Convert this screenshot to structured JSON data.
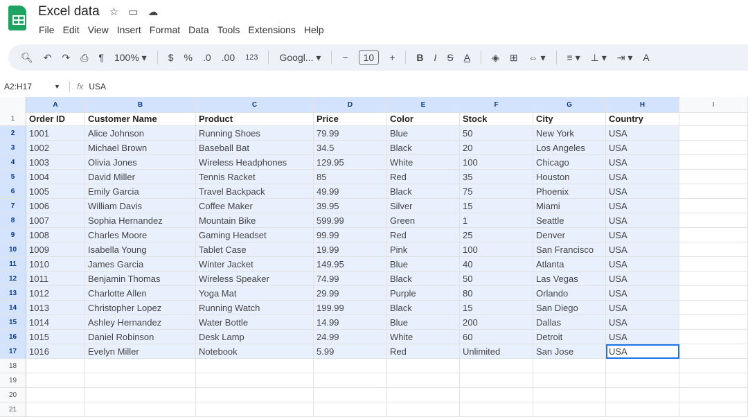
{
  "title": "Excel data",
  "menu": [
    "File",
    "Edit",
    "View",
    "Insert",
    "Format",
    "Data",
    "Tools",
    "Extensions",
    "Help"
  ],
  "toolbar": {
    "zoom": "100%",
    "currency": "$",
    "percent": "%",
    "dec_decrease": ".0",
    "dec_increase": ".00",
    "number_format": "123",
    "font": "Googl...",
    "font_size": "10"
  },
  "formula_bar": {
    "name_box": "A2:H17",
    "fx": "fx",
    "value": "USA"
  },
  "columns": [
    "A",
    "B",
    "C",
    "D",
    "E",
    "F",
    "G",
    "H",
    "I"
  ],
  "rows": [
    [
      "Order ID",
      "Customer Name",
      "Product",
      "Price",
      "Color",
      "Stock",
      "City",
      "Country"
    ],
    [
      "1001",
      "Alice Johnson",
      "Running Shoes",
      "79.99",
      "Blue",
      "50",
      "New York",
      "USA"
    ],
    [
      "1002",
      "Michael Brown",
      "Baseball Bat",
      "34.5",
      "Black",
      "20",
      "Los Angeles",
      "USA"
    ],
    [
      "1003",
      "Olivia Jones",
      "Wireless Headphones",
      "129.95",
      "White",
      "100",
      "Chicago",
      "USA"
    ],
    [
      "1004",
      "David Miller",
      "Tennis Racket",
      "85",
      "Red",
      "35",
      "Houston",
      "USA"
    ],
    [
      "1005",
      "Emily Garcia",
      "Travel Backpack",
      "49.99",
      "Black",
      "75",
      "Phoenix",
      "USA"
    ],
    [
      "1006",
      "William Davis",
      "Coffee Maker",
      "39.95",
      "Silver",
      "15",
      "Miami",
      "USA"
    ],
    [
      "1007",
      "Sophia Hernandez",
      "Mountain Bike",
      "599.99",
      "Green",
      "1",
      "Seattle",
      "USA"
    ],
    [
      "1008",
      "Charles Moore",
      "Gaming Headset",
      "99.99",
      "Red",
      "25",
      "Denver",
      "USA"
    ],
    [
      "1009",
      "Isabella Young",
      "Tablet Case",
      "19.99",
      "Pink",
      "100",
      "San Francisco",
      "USA"
    ],
    [
      "1010",
      "James Garcia",
      "Winter Jacket",
      "149.95",
      "Blue",
      "40",
      "Atlanta",
      "USA"
    ],
    [
      "1011",
      "Benjamin Thomas",
      "Wireless Speaker",
      "74.99",
      "Black",
      "50",
      "Las Vegas",
      "USA"
    ],
    [
      "1012",
      "Charlotte Allen",
      "Yoga Mat",
      "29.99",
      "Purple",
      "80",
      "Orlando",
      "USA"
    ],
    [
      "1013",
      "Christopher Lopez",
      "Running Watch",
      "199.99",
      "Black",
      "15",
      "San Diego",
      "USA"
    ],
    [
      "1014",
      "Ashley Hernandez",
      "Water Bottle",
      "14.99",
      "Blue",
      "200",
      "Dallas",
      "USA"
    ],
    [
      "1015",
      "Daniel Robinson",
      "Desk Lamp",
      "24.99",
      "White",
      "60",
      "Detroit",
      "USA"
    ],
    [
      "1016",
      "Evelyn Miller",
      "Notebook",
      "5.99",
      "Red",
      "Unlimited",
      "San Jose",
      "USA"
    ],
    [
      "",
      "",
      "",
      "",
      "",
      "",
      "",
      ""
    ],
    [
      "",
      "",
      "",
      "",
      "",
      "",
      "",
      ""
    ],
    [
      "",
      "",
      "",
      "",
      "",
      "",
      "",
      ""
    ],
    [
      "",
      "",
      "",
      "",
      "",
      "",
      "",
      ""
    ]
  ]
}
